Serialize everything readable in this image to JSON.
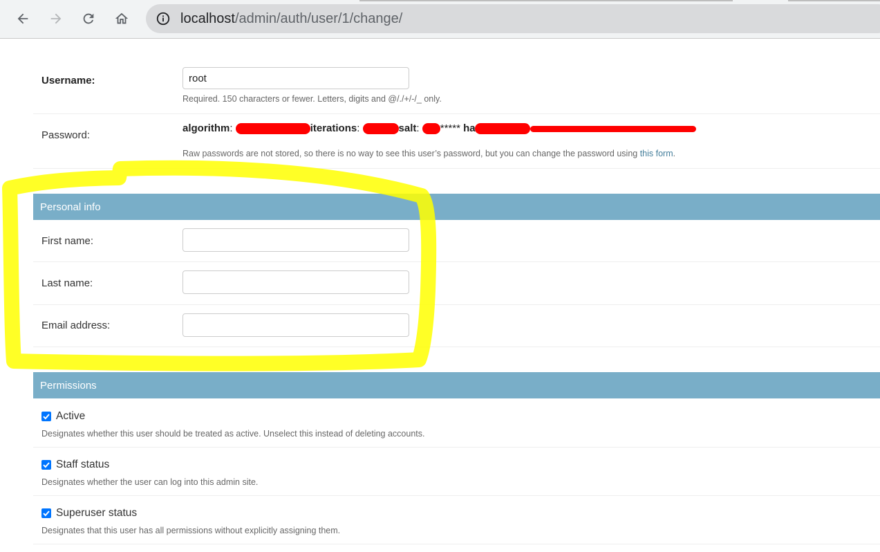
{
  "browser": {
    "url_host": "localhost",
    "url_path": "/admin/auth/user/1/change/",
    "icons": [
      "back-icon",
      "forward-icon",
      "reload-icon",
      "home-icon",
      "info-icon"
    ]
  },
  "form": {
    "username": {
      "label": "Username:",
      "value": "root",
      "help": "Required. 150 characters or fewer. Letters, digits and @/./+/-/_ only."
    },
    "password": {
      "label": "Password:",
      "algorithm_label": "algorithm",
      "iterations_label": "iterations",
      "salt_label": "salt",
      "salt_visible": "*****",
      "hash_label": "hash",
      "hash_visible": "*****************",
      "help_prefix": "Raw passwords are not stored, so there is no way to see this user’s password, but you can change the password using ",
      "help_link": "this form",
      "help_suffix": "."
    }
  },
  "personal_info": {
    "header": "Personal info",
    "first_name_label": "First name:",
    "last_name_label": "Last name:",
    "email_label": "Email address:",
    "first_name_value": "",
    "last_name_value": "",
    "email_value": ""
  },
  "permissions": {
    "header": "Permissions",
    "items": [
      {
        "label": "Active",
        "help": "Designates whether this user should be treated as active. Unselect this instead of deleting accounts.",
        "checked": true
      },
      {
        "label": "Staff status",
        "help": "Designates whether the user can log into this admin site.",
        "checked": true
      },
      {
        "label": "Superuser status",
        "help": "Designates that this user has all permissions without explicitly assigning them.",
        "checked": true
      }
    ]
  },
  "colors": {
    "fieldset_header": "#79aec8",
    "checkbox": "#0075ff",
    "link": "#447e9b",
    "highlight_annotation": "#ffff00",
    "redaction": "#ff0000"
  }
}
